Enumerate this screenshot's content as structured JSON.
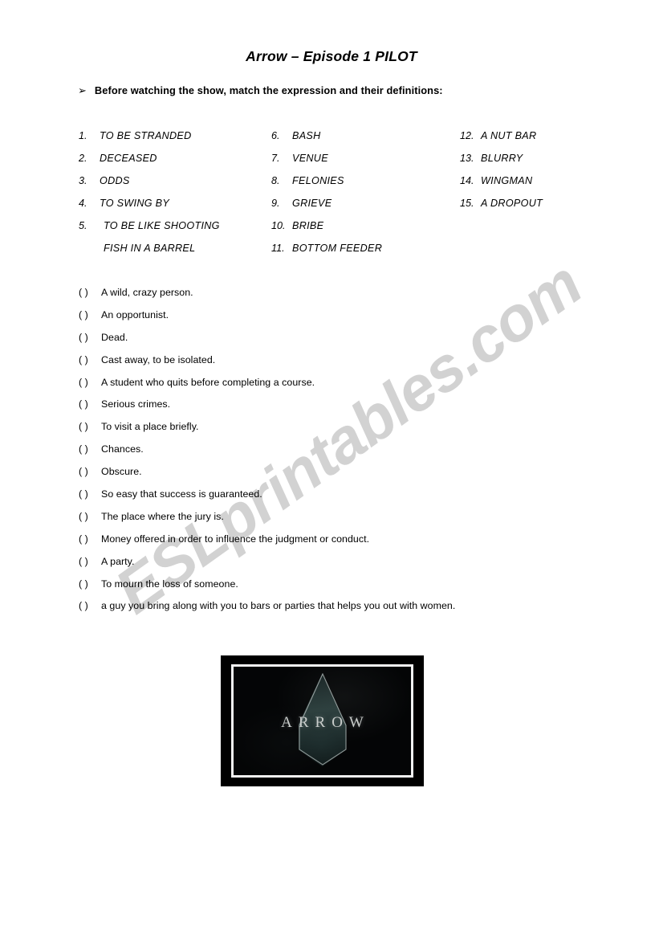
{
  "document": {
    "title": "Arrow – Episode 1 PILOT",
    "instruction_bullet": "➢",
    "instruction": "Before watching the show, match the expression and their definitions:"
  },
  "vocabulary": {
    "column_1": [
      {
        "num": "1.",
        "label": "TO BE STRANDED"
      },
      {
        "num": "2.",
        "label": "DECEASED"
      },
      {
        "num": "3.",
        "label": "ODDS"
      },
      {
        "num": "4.",
        "label": "TO SWING BY"
      },
      {
        "num": "5.",
        "label": "TO BE LIKE SHOOTING",
        "continuation": "FISH IN A BARREL"
      }
    ],
    "column_2": [
      {
        "num": "6.",
        "label": "BASH"
      },
      {
        "num": "7.",
        "label": "VENUE"
      },
      {
        "num": "8.",
        "label": "FELONIES"
      },
      {
        "num": "9.",
        "label": "GRIEVE"
      },
      {
        "num": "10.",
        "label": "BRIBE"
      },
      {
        "num": "11.",
        "label": "BOTTOM FEEDER"
      }
    ],
    "column_3": [
      {
        "num": "12.",
        "label": "A NUT BAR"
      },
      {
        "num": "13.",
        "label": "BLURRY"
      },
      {
        "num": "14.",
        "label": "WINGMAN"
      },
      {
        "num": "15.",
        "label": "A DROPOUT"
      }
    ]
  },
  "definitions": {
    "answer_blank": "(      )",
    "items": [
      "A wild, crazy person.",
      "An opportunist.",
      "Dead.",
      "Cast away, to be isolated.",
      "A student who quits before completing a course.",
      "Serious crimes.",
      "To visit a place briefly.",
      "Chances.",
      "Obscure.",
      "So easy that success is guaranteed.",
      "The place where the jury is.",
      "Money offered in order to influence the judgment or conduct.",
      "A party.",
      "To mourn the loss of someone.",
      "a guy you bring along with you to bars or parties that helps you out with women."
    ]
  },
  "image": {
    "caption_text": "ARROW",
    "alt": "Arrow TV series title card with arrowhead logo"
  },
  "watermark": {
    "text": "ESLprintables.com",
    "color": "#d2d2d2"
  }
}
